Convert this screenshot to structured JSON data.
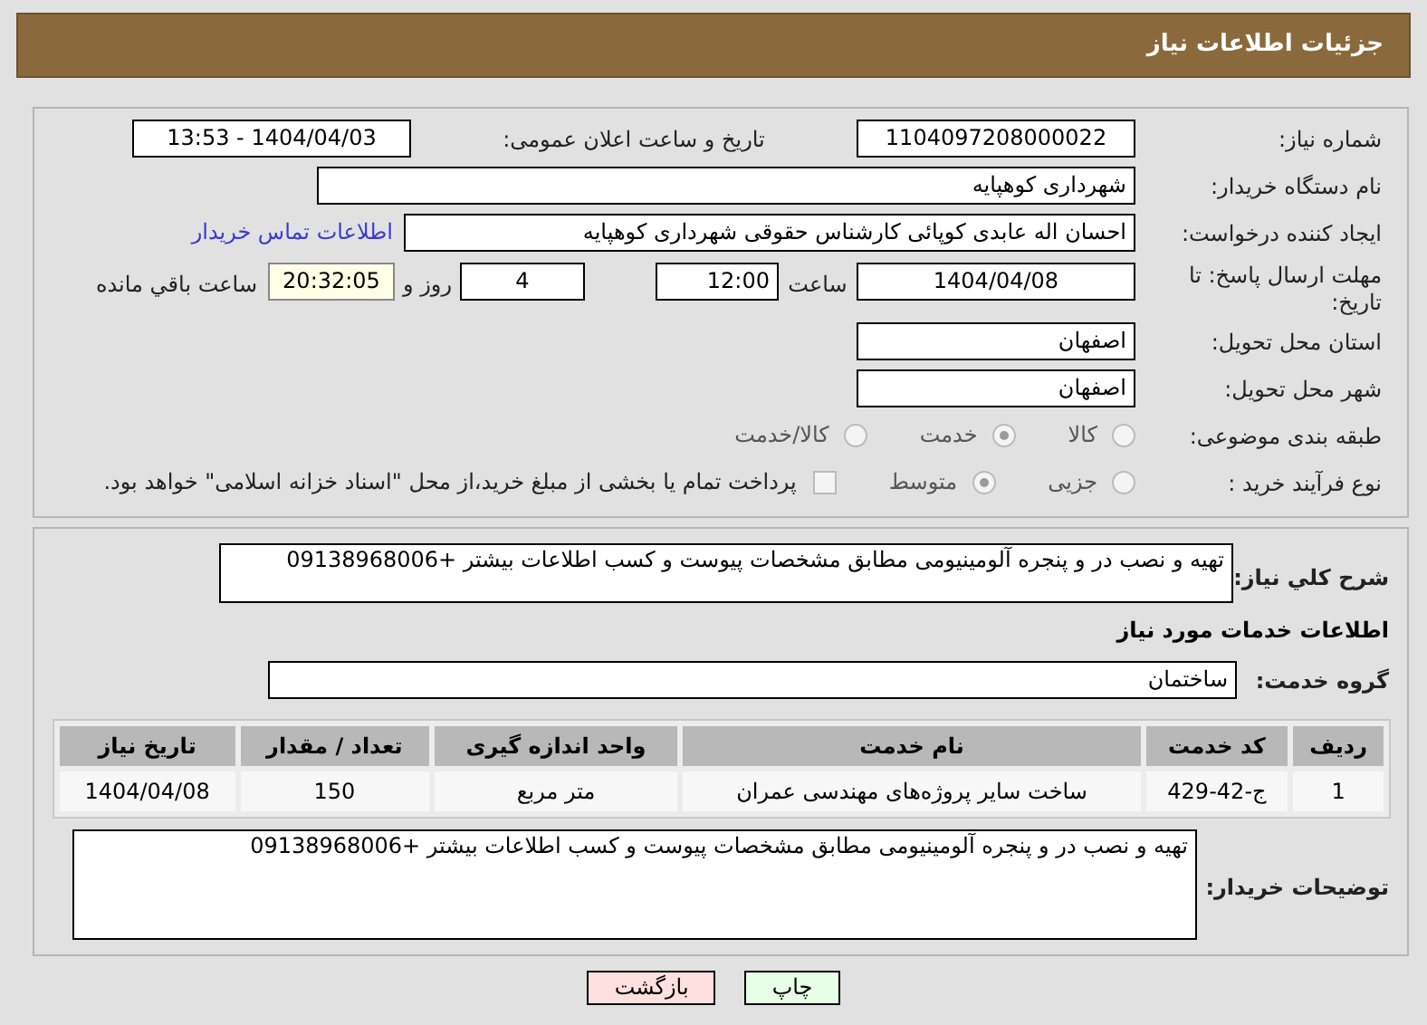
{
  "header": {
    "title": "جزئیات اطلاعات نیاز"
  },
  "details": {
    "need_number": {
      "label": "شماره نیاز:",
      "value": "1104097208000022"
    },
    "announce": {
      "label": "تاریخ و ساعت اعلان عمومی:",
      "value": "1404/04/03 - 13:53"
    },
    "buyer": {
      "label": "نام دستگاه خریدار:",
      "value": "شهرداری کوهپایه"
    },
    "creator": {
      "label": "ایجاد کننده درخواست:",
      "value": "احسان اله عابدی کوپائی کارشناس حقوقی شهرداری کوهپایه",
      "link": "اطلاعات تماس خریدار"
    },
    "deadline": {
      "label": "مهلت ارسال پاسخ: تا تاریخ:",
      "date": "1404/04/08",
      "time_label": "ساعت",
      "time": "12:00",
      "days": "4",
      "days_label": "روز و",
      "remaining": "20:32:05",
      "remaining_label": "ساعت باقي مانده"
    },
    "province": {
      "label": "استان محل تحویل:",
      "value": "اصفهان"
    },
    "city": {
      "label": "شهر محل تحویل:",
      "value": "اصفهان"
    },
    "category": {
      "label": "طبقه بندی موضوعی:",
      "options": [
        {
          "label": "کالا",
          "selected": false
        },
        {
          "label": "خدمت",
          "selected": true
        },
        {
          "label": "کالا/خدمت",
          "selected": false
        }
      ]
    },
    "process": {
      "label": "نوع فرآیند خرید :",
      "options": [
        {
          "label": "جزیی",
          "selected": false
        },
        {
          "label": "متوسط",
          "selected": true
        }
      ],
      "payment": {
        "label": "پرداخت تمام یا بخشی از مبلغ خرید،از محل \"اسناد خزانه اسلامی\" خواهد بود.",
        "checked": false
      }
    }
  },
  "services": {
    "description": {
      "label": "شرح کلي نياز:",
      "value": "تهیه و نصب در و پنجره آلومینیومی مطابق مشخصات پیوست و کسب اطلاعات بیشتر +09138968006"
    },
    "heading": "اطلاعات خدمات مورد نياز",
    "group": {
      "label": "گروه خدمت:",
      "value": "ساختمان"
    },
    "table": {
      "columns": [
        "ردیف",
        "کد خدمت",
        "نام خدمت",
        "واحد اندازه گیری",
        "تعداد / مقدار",
        "تاریخ نیاز"
      ],
      "rows": [
        [
          "1",
          "ج-42-429",
          "ساخت سایر پروژه‌های مهندسی عمران",
          "متر مربع",
          "150",
          "1404/04/08"
        ]
      ]
    },
    "notes": {
      "label": "توضیحات خریدار:",
      "value": "تهیه و نصب در و پنجره آلومینیومی مطابق مشخصات پیوست و کسب اطلاعات بیشتر +09138968006"
    }
  },
  "buttons": [
    {
      "label": "چاپ",
      "kind": "print"
    },
    {
      "label": "بازگشت",
      "kind": "back"
    }
  ]
}
